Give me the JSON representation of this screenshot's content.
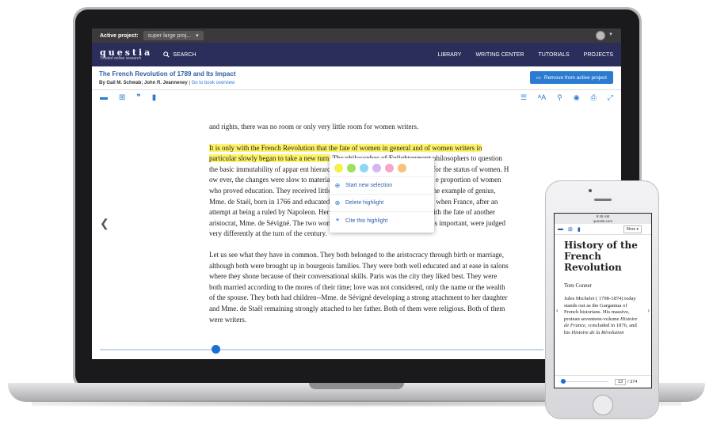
{
  "topbar": {
    "active_project_label": "Active project:",
    "project_value": "super large proj..."
  },
  "navbar": {
    "logo_main": "questia",
    "logo_sub": "Trusted online research",
    "search_label": "SEARCH",
    "links": [
      "LIBRARY",
      "WRITING CENTER",
      "TUTORIALS",
      "PROJECTS"
    ]
  },
  "book": {
    "title": "The French Revolution of 1789 and Its Impact",
    "authors": "By Gail M. Schwab; John R. Jeanneney",
    "overview_link": "Go to book overview",
    "remove_button": "Remove from active project"
  },
  "reader": {
    "p1": "and rights, there was no room or only very little room for women writers.",
    "p2_highlight": "It is only with the French Revolution that the fate of women in general and of women writers in particular slowly began to take a new turn.",
    "p2_rest": " The philosophes of Enlightenment philosophers to question the basic immutability of appar ent hierarchies and revolutionary implications for the status of women. H ow ever, the changes were slow to materialize. Women hoped for much, and th e proportion of women who proved education. They received little. The main point of this ch apter is the example of genius, Mme. de Staël, born in 1766 and educated before the great heaval--particularly when France, after an attempt at being a ruled by Napoleon. Her fate at that time will be compared with the fate of another aristocrat, Mme. de Sévigné. The two women, both of whom are now viewed as important, were judged very differently at the turn of the century.",
    "p3": "Let us see what they have in common. They both belonged to the aristocracy through birth or marriage, although both were brought up in bourgeois families. They were both well educated and at ease in salons where they shone because of their conversational skills. Paris was the city they liked best. They were both married according to the mores of their time; love was not considered, only the name or the wealth of the spouse. They both had children--Mme. de Sévigné developing a strong attachment to her daughter and Mme. de Staël remaining strongly attached to her father. Both of them were religious. Both of them were writers."
  },
  "popup": {
    "swatch_colors": [
      "#f5f04a",
      "#9fe05a",
      "#8fd6f5",
      "#d6b6f2",
      "#f7a8c8",
      "#f7c27a"
    ],
    "items": [
      {
        "icon": "plus-circle-icon",
        "label": "Start new selection"
      },
      {
        "icon": "x-circle-icon",
        "label": "Delete highlight"
      },
      {
        "icon": "quote-icon",
        "label": "Cite this highlight"
      }
    ]
  },
  "progress": {
    "fraction": 0.26
  },
  "phone": {
    "status_time": "9:45 AM",
    "status_url": "questia.com",
    "status_carrier": "●●●●○ 🛜",
    "status_battery": "100% ▬",
    "more_label": "More ▾",
    "title": "History of the French Revolution",
    "author": "Tom Conner",
    "text_html_parts": [
      "Jules Michelet ( 1798-1874) today stands out as the Gargantua of French historians. His massive, protean seventeen-volume ",
      "Histoire de France",
      ", concluded in 1876, and his ",
      "Histoire de la Révolution"
    ],
    "page_current": "13",
    "page_total": "/ 374"
  }
}
